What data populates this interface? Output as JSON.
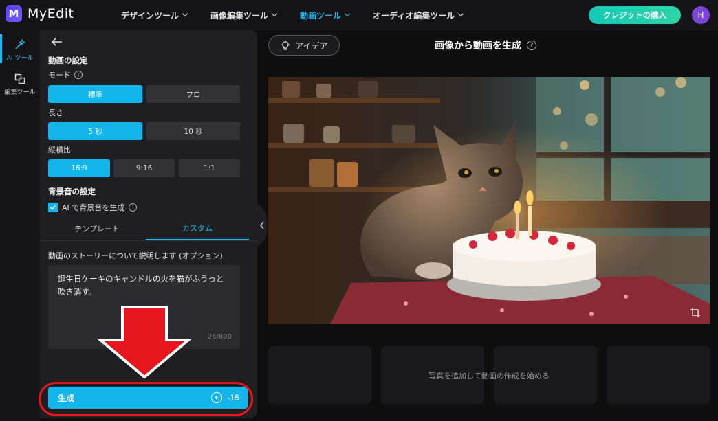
{
  "header": {
    "logo_text": "MyEdit",
    "logo_mark": "M",
    "nav": [
      {
        "label": "デザインツール"
      },
      {
        "label": "画像編集ツール"
      },
      {
        "label": "動画ツール"
      },
      {
        "label": "オーディオ編集ツール"
      }
    ],
    "active_nav": "動画ツール",
    "credit_button": "クレジットの購入",
    "avatar_initial": "H"
  },
  "rail": {
    "items": [
      {
        "label": "AI ツール",
        "icon": "magic-wand-icon"
      },
      {
        "label": "編集ツール",
        "icon": "layers-icon"
      }
    ]
  },
  "settings": {
    "title": "動画の設定",
    "mode": {
      "label": "モード",
      "options": [
        "標準",
        "プロ"
      ],
      "selected": "標準"
    },
    "length": {
      "label": "長さ",
      "options": [
        "5 秒",
        "10 秒"
      ],
      "selected": "5 秒"
    },
    "aspect": {
      "label": "縦横比",
      "options": [
        "16:9",
        "9:16",
        "1:1"
      ],
      "selected": "16:9"
    },
    "bgm_title": "背景音の設定",
    "bgm_checkbox": "AI で背景音を生成",
    "bgm_checked": true,
    "tabs": [
      "テンプレート",
      "カスタム"
    ],
    "active_tab": "カスタム",
    "story_label": "動画のストーリーについて説明します (オプション)",
    "story_text": "誕生日ケーキのキャンドルの火を猫がふうっと吹き消す。",
    "story_counter": "26/800",
    "generate_label": "生成",
    "generate_cost": "-15"
  },
  "main": {
    "idea_button": "アイデア",
    "page_title": "画像から動画を生成",
    "thumb_message": "写真を追加して動画の作成を始める"
  },
  "colors": {
    "accent": "#14b5ea",
    "annotation_red": "#e6171c",
    "credit_button": "#14c9b4",
    "avatar": "#7b45d8"
  }
}
